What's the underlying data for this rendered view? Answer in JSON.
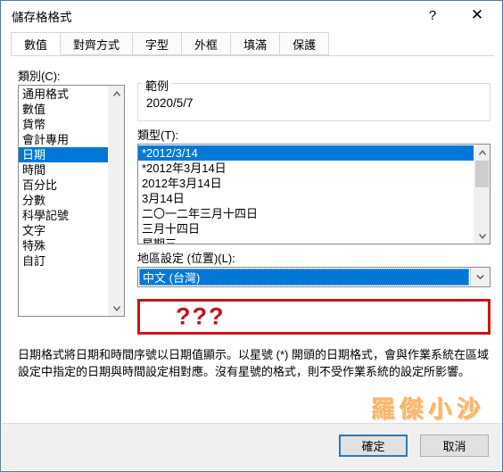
{
  "window": {
    "title": "儲存格格式",
    "help_icon": "?",
    "close_icon": "✕"
  },
  "tabs": [
    {
      "label": "數值",
      "active": true
    },
    {
      "label": "對齊方式",
      "active": false
    },
    {
      "label": "字型",
      "active": false
    },
    {
      "label": "外框",
      "active": false
    },
    {
      "label": "填滿",
      "active": false
    },
    {
      "label": "保護",
      "active": false
    }
  ],
  "category": {
    "label": "類別(C):",
    "items": [
      "通用格式",
      "數值",
      "貨幣",
      "會計專用",
      "日期",
      "時間",
      "百分比",
      "分數",
      "科學記號",
      "文字",
      "特殊",
      "自訂"
    ],
    "selected_index": 4,
    "scroll_up_icon": "▲",
    "scroll_down_icon": "▼"
  },
  "sample": {
    "legend": "範例",
    "value": "2020/5/7"
  },
  "type": {
    "label": "類型(T):",
    "items": [
      "*2012/3/14",
      "*2012年3月14日",
      "2012年3月14日",
      "3月14日",
      "二〇一二年三月十四日",
      "三月十四日",
      "星期三"
    ],
    "selected_index": 0,
    "scroll_up_icon": "▲",
    "scroll_down_icon": "▼"
  },
  "locale": {
    "label": "地區設定 (位置)(L):",
    "value": "中文 (台灣)",
    "arrow_icon": "▼"
  },
  "annotation": {
    "text": "???",
    "border_color": "#cc1414",
    "text_color": "#c01414"
  },
  "description": {
    "text": "日期格式將日期和時間序號以日期值顯示。以星號 (*) 開頭的日期格式，會與作業系統在區域設定中指定的日期與時間設定相對應。沒有星號的格式，則不受作業系統的設定所影響。"
  },
  "watermark": {
    "text": "羅傑小沙",
    "color": "#f7b261"
  },
  "footer": {
    "ok_label": "確定",
    "cancel_label": "取消"
  },
  "colors": {
    "accent": "#0078d7",
    "dialog_bg": "#ffffff",
    "footer_bg": "#f0f0f0",
    "window_border": "#4a7ca8"
  }
}
